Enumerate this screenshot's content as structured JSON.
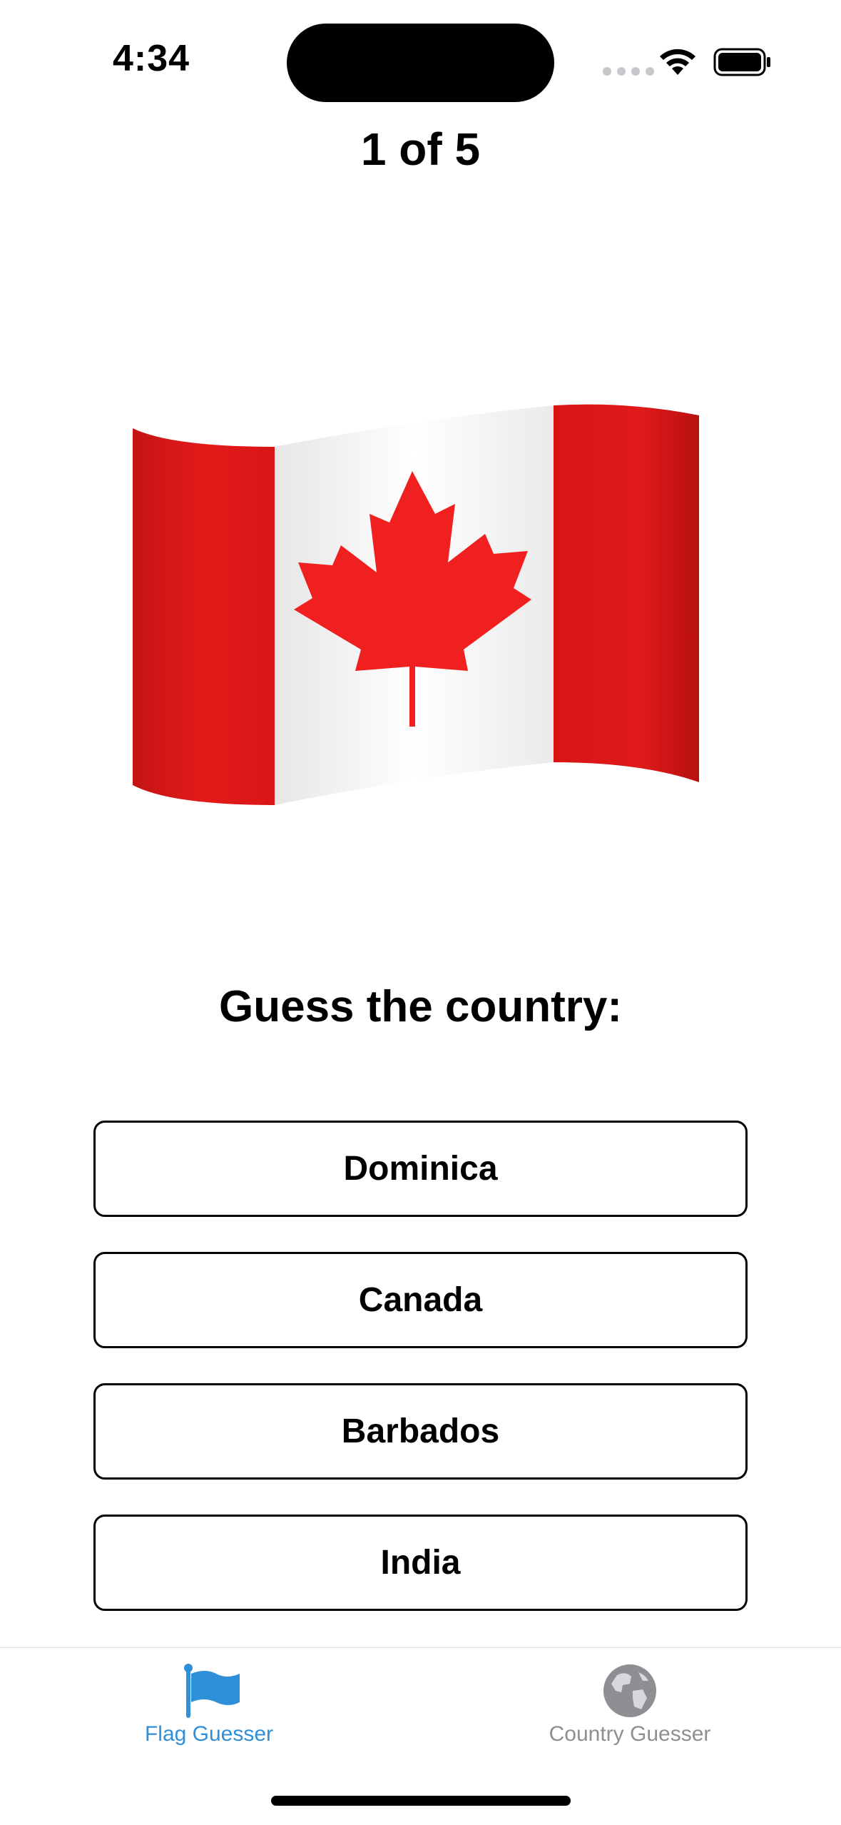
{
  "status_bar": {
    "time": "4:34"
  },
  "quiz": {
    "progress": "1 of 5",
    "prompt": "Guess the country:",
    "flag_icon": "canada-flag-icon",
    "answers": [
      "Dominica",
      "Canada",
      "Barbados",
      "India"
    ]
  },
  "tab_bar": {
    "tabs": [
      {
        "label": "Flag Guesser",
        "icon": "flag-icon",
        "selected": true
      },
      {
        "label": "Country Guesser",
        "icon": "globe-icon",
        "selected": false
      }
    ]
  },
  "colors": {
    "accent": "#2f8fd8",
    "inactive": "#8e8e93",
    "flag_red": "#e01e1e"
  }
}
